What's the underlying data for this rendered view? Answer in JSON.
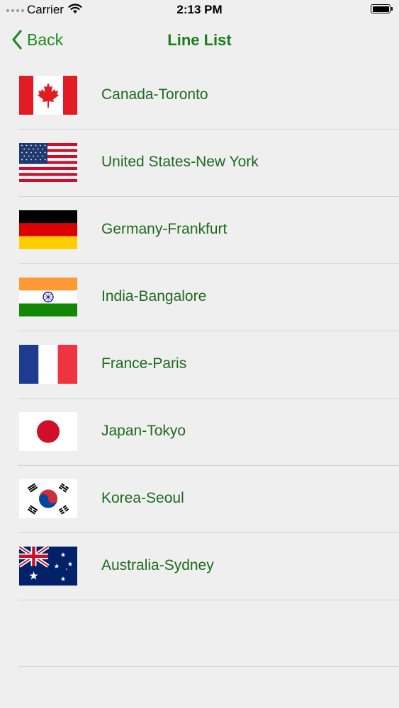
{
  "status_bar": {
    "carrier": "Carrier",
    "time": "2:13 PM"
  },
  "nav": {
    "back_label": "Back",
    "title": "Line List"
  },
  "lines": [
    {
      "label": "Canada-Toronto",
      "flag_icon": "canada-flag-icon"
    },
    {
      "label": "United States-New York",
      "flag_icon": "usa-flag-icon"
    },
    {
      "label": "Germany-Frankfurt",
      "flag_icon": "germany-flag-icon"
    },
    {
      "label": "India-Bangalore",
      "flag_icon": "india-flag-icon"
    },
    {
      "label": "France-Paris",
      "flag_icon": "france-flag-icon"
    },
    {
      "label": "Japan-Tokyo",
      "flag_icon": "japan-flag-icon"
    },
    {
      "label": "Korea-Seoul",
      "flag_icon": "korea-flag-icon"
    },
    {
      "label": "Australia-Sydney",
      "flag_icon": "australia-flag-icon"
    }
  ],
  "colors": {
    "accent": "#1f8c1f",
    "label_text": "#1e6a1e",
    "background": "#efefef"
  }
}
